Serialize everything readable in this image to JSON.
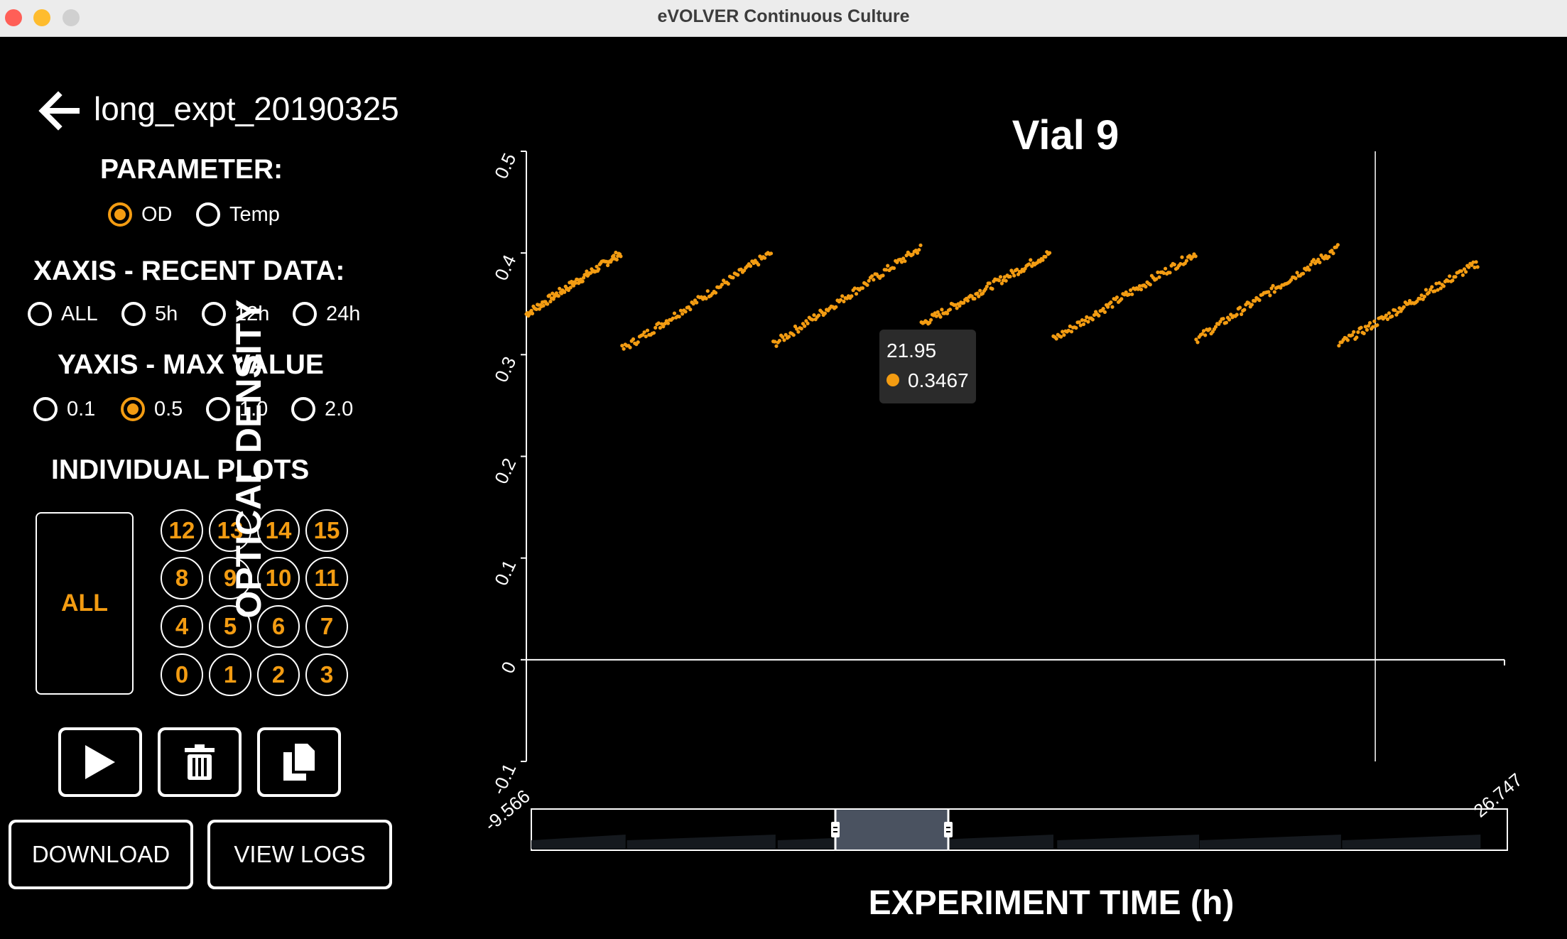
{
  "window": {
    "title": "eVOLVER Continuous Culture"
  },
  "sidebar": {
    "experiment_name": "long_expt_20190325",
    "parameter": {
      "heading": "PARAMETER:",
      "options": [
        "OD",
        "Temp"
      ],
      "selected": "OD"
    },
    "xaxis": {
      "heading": "XAXIS - RECENT DATA:",
      "options": [
        "ALL",
        "5h",
        "12h",
        "24h"
      ],
      "selected": ""
    },
    "yaxis": {
      "heading": "YAXIS - MAX VALUE",
      "options": [
        "0.1",
        "0.5",
        "1.0",
        "2.0"
      ],
      "selected": "0.5"
    },
    "plots": {
      "heading": "INDIVIDUAL PLOTS",
      "all_label": "ALL",
      "vial_rows": [
        [
          "12",
          "13",
          "14",
          "15"
        ],
        [
          "8",
          "9",
          "10",
          "11"
        ],
        [
          "4",
          "5",
          "6",
          "7"
        ],
        [
          "0",
          "1",
          "2",
          "3"
        ]
      ]
    },
    "actions": {
      "play_icon": "play-icon",
      "delete_icon": "trash-icon",
      "copy_icon": "copy-icon"
    },
    "buttons": {
      "download": "DOWNLOAD",
      "view_logs": "VIEW LOGS"
    }
  },
  "chart": {
    "title": "Vial 9",
    "xlabel": "EXPERIMENT TIME (h)",
    "ylabel": "OPTICAL DENSITY",
    "tooltip": {
      "x": "21.95",
      "y": "0.3467"
    },
    "range_labels": {
      "min": "-9.566",
      "max": "26.747"
    }
  },
  "colors": {
    "accent": "#f39c12",
    "background": "#000000"
  },
  "chart_data": {
    "type": "scatter",
    "title": "Vial 9",
    "xlabel": "EXPERIMENT TIME (h)",
    "ylabel": "OPTICAL DENSITY",
    "xlim": [
      -9.566,
      26.747
    ],
    "ylim": [
      -0.1,
      0.5
    ],
    "yticks": [
      "-0.1",
      "0",
      "0.1",
      "0.2",
      "0.3",
      "0.4",
      "0.5"
    ],
    "grid": false,
    "crosshair_x": 21.95,
    "series": [
      {
        "segments": [
          {
            "x": [
              -9.566,
              -6.06
            ],
            "y": [
              0.34,
              0.4
            ]
          },
          {
            "x": [
              -6.01,
              -0.48
            ],
            "y": [
              0.305,
              0.4
            ]
          },
          {
            "x": [
              -0.4,
              5.07
            ],
            "y": [
              0.31,
              0.405
            ]
          },
          {
            "x": [
              5.1,
              9.86
            ],
            "y": [
              0.33,
              0.4
            ]
          },
          {
            "x": [
              10.0,
              15.28
            ],
            "y": [
              0.315,
              0.4
            ]
          },
          {
            "x": [
              15.3,
              20.56
            ],
            "y": [
              0.315,
              0.405
            ]
          },
          {
            "x": [
              20.6,
              25.75
            ],
            "y": [
              0.31,
              0.39
            ]
          }
        ]
      }
    ]
  }
}
